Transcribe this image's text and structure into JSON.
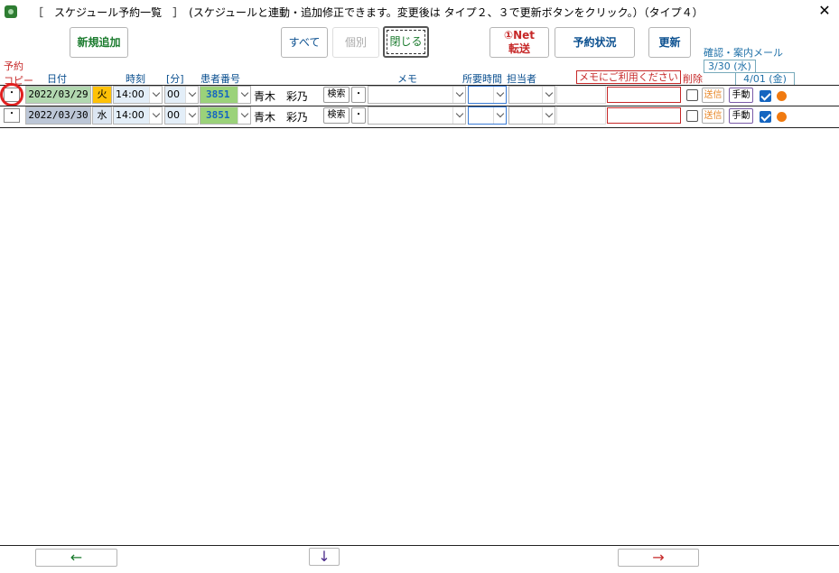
{
  "window": {
    "title": "［　スケジュール予約一覧　］　(スケジュールと連動・追加修正できます。変更後は タイプ２、３で更新ボタンをクリック。）（タイプ４）",
    "close": "✕"
  },
  "toolbar": {
    "new_add": "新規追加",
    "all": "すべて",
    "individual": "個別",
    "close": "閉じる",
    "net_line1": "①Net",
    "net_line2": "転送",
    "reserve_status": "予約状況",
    "update": "更新"
  },
  "headers": {
    "copy_line1": "予約",
    "copy_line2": "コピー",
    "date": "日付",
    "time": "時刻",
    "minute": "[分]",
    "patient_no": "患者番号",
    "memo": "メモ",
    "duration": "所要時間",
    "staff": "担当者",
    "memo_note": "メモにご利用ください",
    "delete": "削除",
    "confirm_mail": "確認・案内メール",
    "date_chip_1": "3/30 (水)",
    "date_chip_2": "4/01 (金)"
  },
  "rows": [
    {
      "copy": "・",
      "date": "2022/03/29",
      "dow": "火",
      "hour": "14:00",
      "minute": "00",
      "patient_no": "3851",
      "name": "青木　彩乃",
      "search": "検索",
      "dot_btn": "・",
      "send": "送信",
      "manual": "手動"
    },
    {
      "copy": "・",
      "date": "2022/03/30",
      "dow": "水",
      "hour": "14:00",
      "minute": "00",
      "patient_no": "3851",
      "name": "青木　彩乃",
      "search": "検索",
      "dot_btn": "・",
      "send": "送信",
      "manual": "手動"
    }
  ],
  "nav": {
    "prev": "←",
    "down": "↓",
    "next": "→"
  },
  "colors": {
    "green_text": "#1b7b2e",
    "red_text": "#c62828",
    "date_green": "#b2d8b0",
    "date_gray": "#bcc6d6",
    "orange_dot": "#f07a10",
    "check_blue": "#1565c0"
  }
}
